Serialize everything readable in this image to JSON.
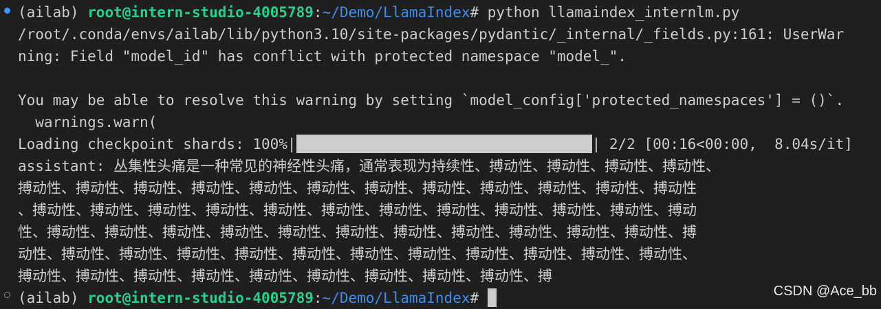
{
  "colors": {
    "background": "#1f1f1f",
    "text": "#cccccc",
    "user_host": "#23d18b",
    "path": "#3b8eea",
    "status_dot": "#3794ff"
  },
  "prompt1": {
    "env": "(ailab) ",
    "user_host": "root@intern-studio-4005789",
    "colon": ":",
    "path": "~/Demo/LlamaIndex",
    "symbol": "# ",
    "command": "python llamaindex_internlm.py"
  },
  "warning": {
    "line1": "/root/.conda/envs/ailab/lib/python3.10/site-packages/pydantic/_internal/_fields.py:161: UserWar",
    "line2": "ning: Field \"model_id\" has conflict with protected namespace \"model_\".",
    "line3": "",
    "line4": "You may be able to resolve this warning by setting `model_config['protected_namespaces'] = ()`.",
    "line5": "  warnings.warn("
  },
  "progress": {
    "prefix": "Loading checkpoint shards: 100%|",
    "suffix": "| 2/2 [00:16<00:00,  8.04s/it]",
    "percent": 100
  },
  "output": {
    "line1": "assistant: 丛集性头痛是一种常见的神经性头痛，通常表现为持续性、搏动性、搏动性、搏动性、搏动性、",
    "line2": "搏动性、搏动性、搏动性、搏动性、搏动性、搏动性、搏动性、搏动性、搏动性、搏动性、搏动性、搏动性",
    "line3": "、搏动性、搏动性、搏动性、搏动性、搏动性、搏动性、搏动性、搏动性、搏动性、搏动性、搏动性、搏动",
    "line4": "性、搏动性、搏动性、搏动性、搏动性、搏动性、搏动性、搏动性、搏动性、搏动性、搏动性、搏动性、搏",
    "line5": "动性、搏动性、搏动性、搏动性、搏动性、搏动性、搏动性、搏动性、搏动性、搏动性、搏动性、搏动性、",
    "line6": "搏动性、搏动性、搏动性、搏动性、搏动性、搏动性、搏动性、搏动性、搏动性、搏"
  },
  "prompt2": {
    "env": "(ailab) ",
    "user_host": "root@intern-studio-4005789",
    "colon": ":",
    "path": "~/Demo/LlamaIndex",
    "symbol": "# "
  },
  "watermark": "CSDN @Ace_bb"
}
